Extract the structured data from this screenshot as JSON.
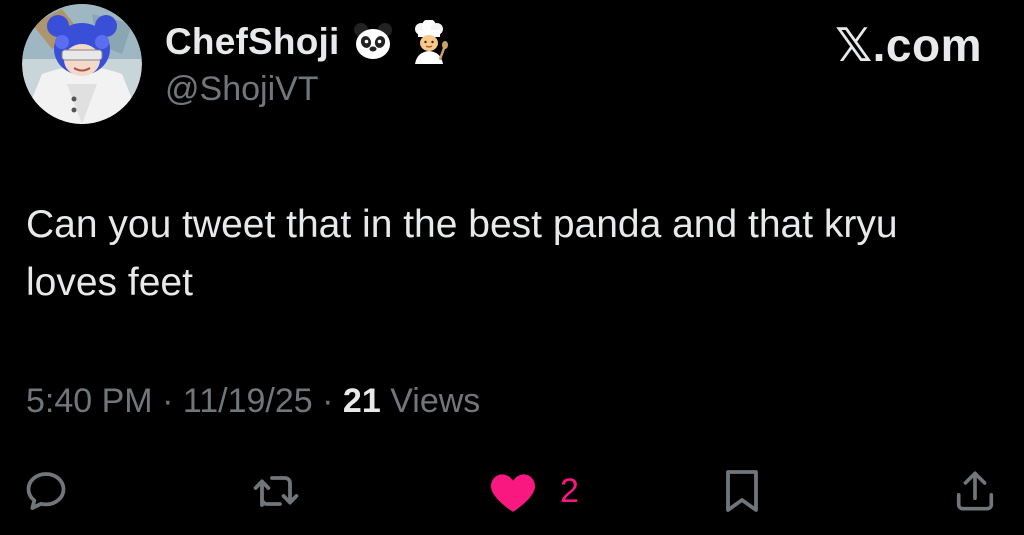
{
  "author": {
    "display_name": "ChefShoji",
    "handle": "@ShojiVT",
    "emojis": [
      "panda-face-icon",
      "cook-icon"
    ],
    "avatar": "avatar-icon"
  },
  "brand": "𝕏.com",
  "tweet": {
    "text": "Can you tweet that in the best panda and that kryu loves feet"
  },
  "meta": {
    "time": "5:40 PM",
    "separator": "·",
    "date": "11/19/25",
    "views_count": "21",
    "views_label": "Views"
  },
  "actions": {
    "reply_icon": "reply-icon",
    "repost_icon": "repost-icon",
    "like_icon": "heart-icon",
    "like_count": "2",
    "bookmark_icon": "bookmark-icon",
    "share_icon": "share-icon"
  },
  "colors": {
    "background": "#000000",
    "primary_text": "#e7e9ea",
    "secondary_text": "#71767b",
    "like": "#f91880"
  }
}
